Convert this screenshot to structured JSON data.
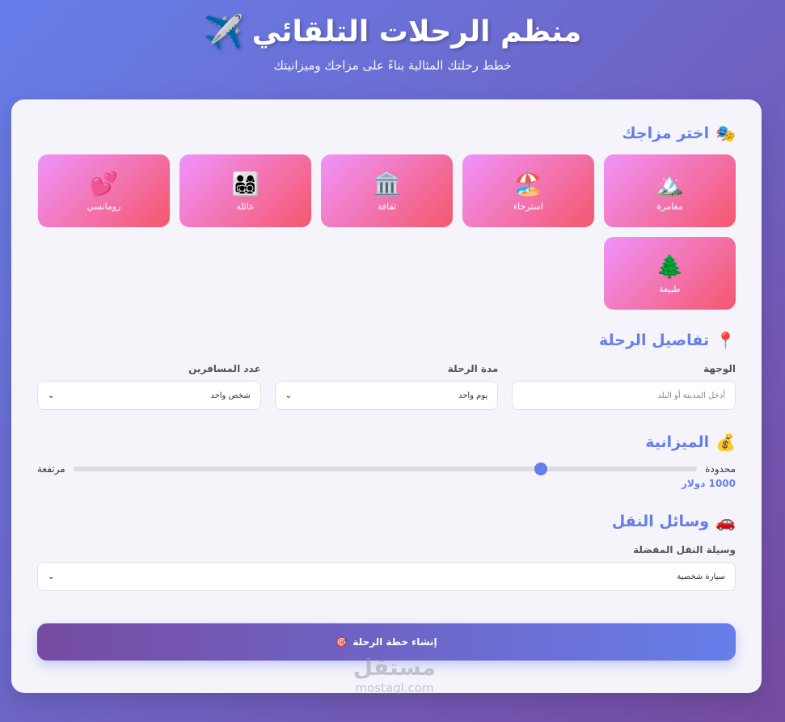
{
  "header": {
    "title": "منظم الرحلات التلقائي",
    "title_icon": "✈️",
    "subtitle": "خطط رحلتك المثالية بناءً على مزاجك وميزانيتك"
  },
  "mood_section": {
    "title": "اختر مزاجك",
    "icon": "🎭",
    "moods": [
      {
        "icon": "🏔️",
        "label": "مغامرة"
      },
      {
        "icon": "🏖️",
        "label": "استرخاء"
      },
      {
        "icon": "🏛️",
        "label": "ثقافة"
      },
      {
        "icon": "👨‍👩‍👧‍👦",
        "label": "عائلة"
      },
      {
        "icon": "💕",
        "label": "رومانسي"
      },
      {
        "icon": "🌲",
        "label": "طبيعة"
      }
    ]
  },
  "details_section": {
    "title": "تفاصيل الرحلة",
    "icon": "📍",
    "destination": {
      "label": "الوجهة",
      "placeholder": "أدخل المدينة أو البلد"
    },
    "duration": {
      "label": "مدة الرحلة",
      "value": "يوم واحد"
    },
    "travelers": {
      "label": "عدد المسافرين",
      "value": "شخص واحد"
    }
  },
  "budget_section": {
    "title": "الميزانية",
    "icon": "💰",
    "min_label": "محدودة",
    "max_label": "مرتفعة",
    "value_text": "1000 دولار",
    "level": 0.25
  },
  "transport_section": {
    "title": "وسائل النقل",
    "icon": "🚗",
    "label": "وسيلة النقل المفضلة",
    "value": "سيارة شخصية"
  },
  "submit": {
    "label": "إنشاء خطة الرحلة",
    "icon": "🎯"
  },
  "watermark": {
    "arabic": "مستقل",
    "latin": "mostaql.com"
  }
}
